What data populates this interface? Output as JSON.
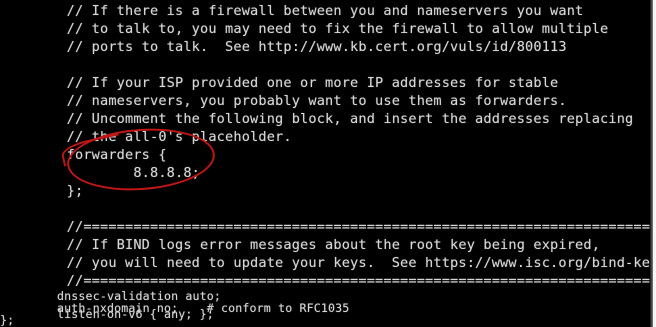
{
  "terminal": {
    "lines": [
      "        // If there is a firewall between you and nameservers you want",
      "        // to talk to, you may need to fix the firewall to allow multiple",
      "        // ports to talk.  See http://www.kb.cert.org/vuls/id/800113",
      "",
      "        // If your ISP provided one or more IP addresses for stable",
      "        // nameservers, you probably want to use them as forwarders.",
      "        // Uncomment the following block, and insert the addresses replacing",
      "        // the all-0's placeholder.",
      "        forwarders {",
      "                8.8.8.8;",
      "        };",
      "",
      "        //========================================================================",
      "        // If BIND logs error messages about the root key being expired,",
      "        // you will need to update your keys.  See https://www.isc.org/bind-keys",
      "        //========================================================================",
      "        dnssec-validation auto;",
      "",
      "        auth-nxdomain no;    # conform to RFC1035",
      "        listen-on-v6 { any; };",
      "};"
    ]
  },
  "annotation": {
    "color": "#c01616"
  }
}
